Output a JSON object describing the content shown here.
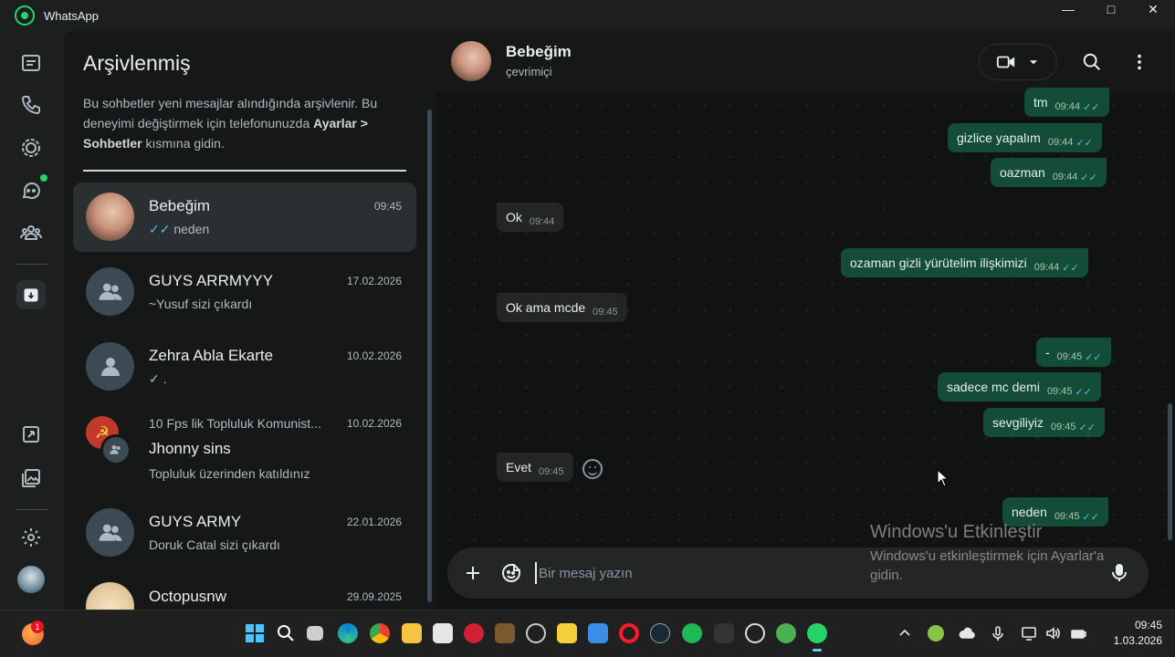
{
  "window": {
    "title": "WhatsApp",
    "minimize": "—",
    "maximize": "□",
    "close": "✕"
  },
  "sidebar": {
    "title": "Arşivlenmiş",
    "description_1": "Bu sohbetler yeni mesajlar alındığında arşivlenir. Bu deneyimi değiştirmek için telefonunuzda ",
    "description_bold_1": "Ayarlar > Sohbetler",
    "description_2": " kısmına gidin.",
    "chats": [
      {
        "name": "Bebeğim",
        "time": "09:45",
        "ticks": "✓✓",
        "preview": "neden"
      },
      {
        "name": "GUYS ARRMYYY",
        "time": "17.02.2026",
        "preview": "~Yusuf sizi çıkardı"
      },
      {
        "name": "Zehra Abla Ekarte",
        "time": "10.02.2026",
        "ticks": "✓",
        "preview": "."
      },
      {
        "community": "10 Fps lik Topluluk Komunist...",
        "name": "Jhonny sins",
        "time": "10.02.2026",
        "preview": "Topluluk üzerinden katıldınız"
      },
      {
        "name": "GUYS ARMY",
        "time": "22.01.2026",
        "preview": "Doruk Catal sizi çıkardı"
      },
      {
        "name": "Octopusnw",
        "time": "29.09.2025",
        "preview": ""
      }
    ]
  },
  "chat": {
    "name": "Bebeğim",
    "status": "çevrimiçi",
    "messages": [
      {
        "dir": "out",
        "text": "tm",
        "time": "09:44",
        "ticks": "✓✓"
      },
      {
        "dir": "out",
        "text": "gizlice yapalım",
        "time": "09:44",
        "ticks": "✓✓"
      },
      {
        "dir": "out",
        "text": "oazman",
        "time": "09:44",
        "ticks": "✓✓"
      },
      {
        "dir": "in",
        "text": "Ok",
        "time": "09:44"
      },
      {
        "dir": "out",
        "text": "ozaman gizli yürütelim ilişkimizi",
        "time": "09:44",
        "ticks": "✓✓"
      },
      {
        "dir": "in",
        "text": "Ok ama mcde",
        "time": "09:45"
      },
      {
        "dir": "out",
        "text": "-",
        "time": "09:45",
        "ticks": "✓✓"
      },
      {
        "dir": "out",
        "text": "sadece mc demi",
        "time": "09:45",
        "ticks": "✓✓"
      },
      {
        "dir": "out",
        "text": "sevgiliyiz",
        "time": "09:45",
        "ticks": "✓✓"
      },
      {
        "dir": "in",
        "text": "Evet",
        "time": "09:45"
      },
      {
        "dir": "out",
        "text": "neden",
        "time": "09:45",
        "ticks": "✓✓"
      }
    ],
    "composer_placeholder": "Bir mesaj yazın"
  },
  "watermark": {
    "line1": "Windows'u Etkinleştir",
    "line2": "Windows'u etkinleştirmek için Ayarlar'a gidin."
  },
  "taskbar": {
    "notification_count": "1",
    "clock_time": "09:45",
    "clock_date": "1.03.2026"
  },
  "colors": {
    "accent_green": "#25d366",
    "outgoing_bubble": "#144d37",
    "incoming_bubble": "#242626",
    "read_tick": "#53bdeb"
  }
}
